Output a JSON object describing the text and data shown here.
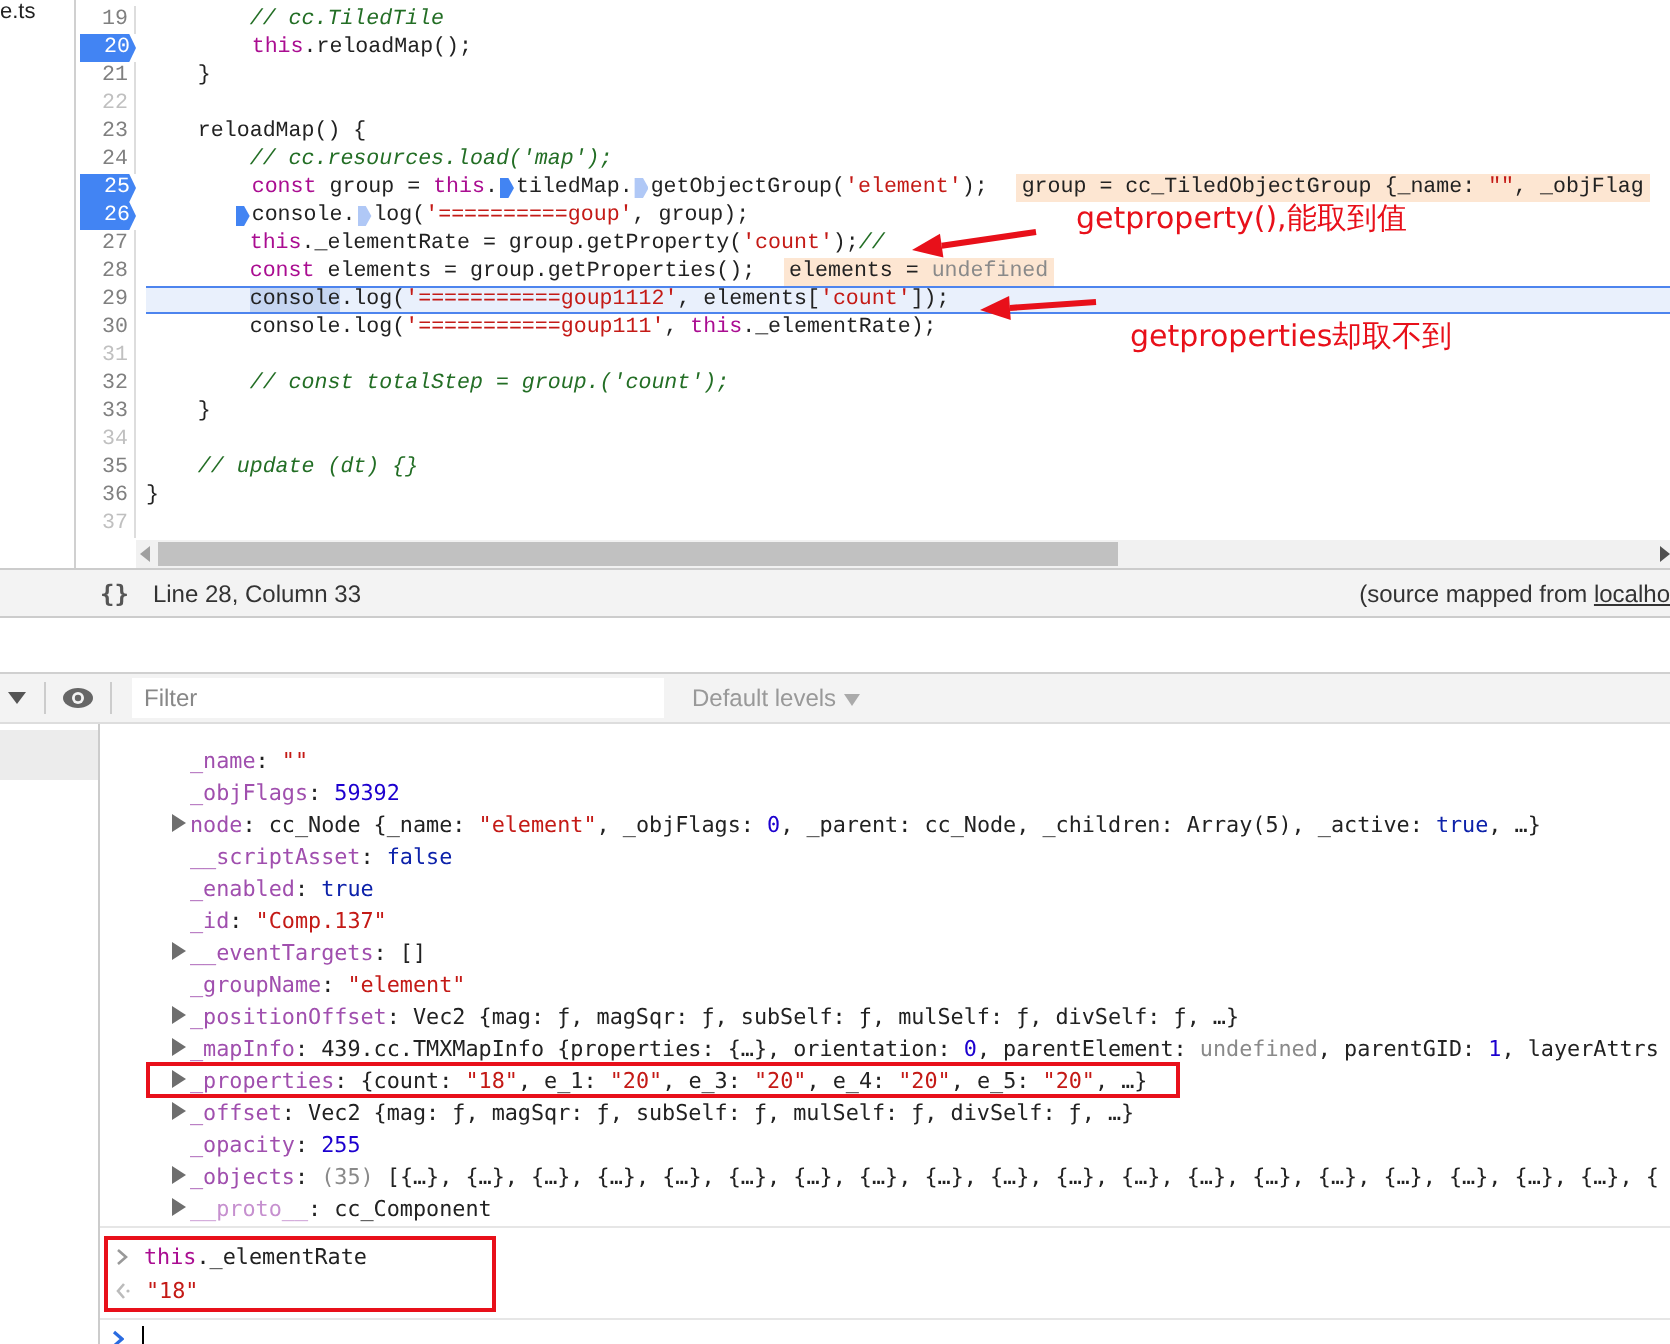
{
  "file_tree": {
    "items": [
      {
        "label": "e.ts"
      }
    ]
  },
  "code": {
    "lines": [
      {
        "number": "19",
        "breakpoint": false,
        "current": false,
        "tokens": [
          {
            "text": "        // cc.TiledTile",
            "kind": "comment"
          }
        ]
      },
      {
        "number": "20",
        "breakpoint": true,
        "current": false,
        "tokens": [
          {
            "text": "        this",
            "kind": "keyword"
          },
          {
            "text": ".reloadMap();",
            "kind": "plain"
          }
        ]
      },
      {
        "number": "21",
        "breakpoint": false,
        "current": false,
        "tokens": [
          {
            "text": "    }",
            "kind": "plain"
          }
        ]
      },
      {
        "number": "22",
        "breakpoint": false,
        "current": false
      },
      {
        "number": "23",
        "breakpoint": false,
        "current": false,
        "tokens": [
          {
            "text": "    reloadMap() {",
            "kind": "plain"
          }
        ]
      },
      {
        "number": "24",
        "breakpoint": false,
        "current": false,
        "tokens": [
          {
            "text": "        // cc.resources.load('map');",
            "kind": "comment"
          }
        ]
      },
      {
        "number": "25",
        "breakpoint": true,
        "current": false,
        "tokens": [
          {
            "text": "        const",
            "kind": "keyword"
          },
          {
            "text": " group = ",
            "kind": "plain"
          },
          {
            "text": "this",
            "kind": "keyword"
          },
          {
            "text": ".",
            "kind": "plain"
          },
          {
            "kind": "marker",
            "active": true
          },
          {
            "text": "tiledMap.",
            "kind": "plain"
          },
          {
            "kind": "marker",
            "active": false
          },
          {
            "text": "getObjectGroup(",
            "kind": "plain"
          },
          {
            "text": "'element'",
            "kind": "string"
          },
          {
            "text": ");",
            "kind": "plain"
          }
        ],
        "hint": [
          {
            "text": "group = cc_TiledObjectGroup {_name: ",
            "kind": "plain"
          },
          {
            "text": "\"\"",
            "kind": "string"
          },
          {
            "text": ", _objFlag",
            "kind": "plain"
          }
        ]
      },
      {
        "number": "26",
        "breakpoint": true,
        "current": false,
        "tokens": [
          {
            "kind": "marker",
            "active": true
          },
          {
            "text": "console.",
            "kind": "plain"
          },
          {
            "kind": "marker",
            "active": false
          },
          {
            "text": "log(",
            "kind": "plain"
          },
          {
            "text": "'==========goup'",
            "kind": "string"
          },
          {
            "text": ", group);",
            "kind": "plain"
          }
        ]
      },
      {
        "number": "27",
        "breakpoint": false,
        "current": false,
        "tokens": [
          {
            "text": "        this",
            "kind": "keyword"
          },
          {
            "text": "._elementRate = group.getProperty(",
            "kind": "plain"
          },
          {
            "text": "'count'",
            "kind": "string"
          },
          {
            "text": ");",
            "kind": "plain"
          },
          {
            "text": "//",
            "kind": "comment"
          }
        ]
      },
      {
        "number": "28",
        "breakpoint": false,
        "current": false,
        "tokens": [
          {
            "text": "        const",
            "kind": "keyword"
          },
          {
            "text": " elements = group.getProperties();",
            "kind": "plain"
          }
        ],
        "hint": [
          {
            "text": "elements = ",
            "kind": "plain"
          },
          {
            "text": "undefined",
            "kind": "gray"
          }
        ]
      },
      {
        "number": "29",
        "breakpoint": false,
        "current": true,
        "tokens": [
          {
            "text": "        console",
            "kind": "selected"
          },
          {
            "text": ".log(",
            "kind": "plain"
          },
          {
            "text": "'===========goup1112'",
            "kind": "string"
          },
          {
            "text": ", elements[",
            "kind": "plain"
          },
          {
            "text": "'count'",
            "kind": "string"
          },
          {
            "text": "]);",
            "kind": "plain"
          }
        ]
      },
      {
        "number": "30",
        "breakpoint": false,
        "current": false,
        "tokens": [
          {
            "text": "        console.log(",
            "kind": "plain"
          },
          {
            "text": "'===========goup111'",
            "kind": "string"
          },
          {
            "text": ", ",
            "kind": "plain"
          },
          {
            "text": "this",
            "kind": "keyword"
          },
          {
            "text": "._elementRate);",
            "kind": "plain"
          }
        ]
      },
      {
        "number": "31",
        "breakpoint": false,
        "current": false
      },
      {
        "number": "32",
        "breakpoint": false,
        "current": false,
        "tokens": [
          {
            "text": "        // const totalStep = group.('count');",
            "kind": "comment"
          }
        ]
      },
      {
        "number": "33",
        "breakpoint": false,
        "current": false,
        "tokens": [
          {
            "text": "    }",
            "kind": "plain"
          }
        ]
      },
      {
        "number": "34",
        "breakpoint": false,
        "current": false
      },
      {
        "number": "35",
        "breakpoint": false,
        "current": false,
        "tokens": [
          {
            "text": "    // update (dt) {}",
            "kind": "comment"
          }
        ]
      },
      {
        "number": "36",
        "breakpoint": false,
        "current": false,
        "tokens": [
          {
            "text": "}",
            "kind": "plain"
          }
        ]
      },
      {
        "number": "37",
        "breakpoint": false,
        "current": false
      }
    ],
    "annotations": [
      {
        "text": "getproperty(),能取到值"
      },
      {
        "text": "getproperties却取不到"
      }
    ]
  },
  "status_bar": {
    "format_button": "{}",
    "position": "Line 28, Column 33",
    "source_prefix": "(source mapped from ",
    "source_link": "localho"
  },
  "console": {
    "filter": {
      "placeholder": "Filter"
    },
    "levels": "Default levels",
    "rows": [
      {
        "expandable": false,
        "boxed": false,
        "tokens": [
          {
            "text": "_name",
            "kind": "key"
          },
          {
            "text": ": ",
            "kind": "plain"
          },
          {
            "text": "\"\"",
            "kind": "string"
          }
        ]
      },
      {
        "expandable": false,
        "boxed": false,
        "tokens": [
          {
            "text": "_objFlags",
            "kind": "key"
          },
          {
            "text": ": ",
            "kind": "plain"
          },
          {
            "text": "59392",
            "kind": "number"
          }
        ]
      },
      {
        "expandable": true,
        "boxed": false,
        "tokens": [
          {
            "text": "node",
            "kind": "key"
          },
          {
            "text": ": cc_Node {_name: ",
            "kind": "plain"
          },
          {
            "text": "\"element\"",
            "kind": "string"
          },
          {
            "text": ", _objFlags: ",
            "kind": "plain"
          },
          {
            "text": "0",
            "kind": "number"
          },
          {
            "text": ", _parent: cc_Node, _children: Array(5), _active: ",
            "kind": "plain"
          },
          {
            "text": "true",
            "kind": "boolean"
          },
          {
            "text": ", …}",
            "kind": "plain"
          }
        ]
      },
      {
        "expandable": false,
        "boxed": false,
        "tokens": [
          {
            "text": "__scriptAsset",
            "kind": "key"
          },
          {
            "text": ": ",
            "kind": "plain"
          },
          {
            "text": "false",
            "kind": "boolean"
          }
        ]
      },
      {
        "expandable": false,
        "boxed": false,
        "tokens": [
          {
            "text": "_enabled",
            "kind": "key"
          },
          {
            "text": ": ",
            "kind": "plain"
          },
          {
            "text": "true",
            "kind": "boolean"
          }
        ]
      },
      {
        "expandable": false,
        "boxed": false,
        "tokens": [
          {
            "text": "_id",
            "kind": "key"
          },
          {
            "text": ": ",
            "kind": "plain"
          },
          {
            "text": "\"Comp.137\"",
            "kind": "string"
          }
        ]
      },
      {
        "expandable": true,
        "boxed": false,
        "tokens": [
          {
            "text": "__eventTargets",
            "kind": "key"
          },
          {
            "text": ": []",
            "kind": "plain"
          }
        ]
      },
      {
        "expandable": false,
        "boxed": false,
        "tokens": [
          {
            "text": "_groupName",
            "kind": "key"
          },
          {
            "text": ": ",
            "kind": "plain"
          },
          {
            "text": "\"element\"",
            "kind": "string"
          }
        ]
      },
      {
        "expandable": true,
        "boxed": false,
        "tokens": [
          {
            "text": "_positionOffset",
            "kind": "key"
          },
          {
            "text": ": Vec2 {mag: ƒ, magSqr: ƒ, subSelf: ƒ, mulSelf: ƒ, divSelf: ƒ, …}",
            "kind": "plain"
          }
        ]
      },
      {
        "expandable": true,
        "boxed": false,
        "tokens": [
          {
            "text": "_mapInfo",
            "kind": "key"
          },
          {
            "text": ": 439.cc.TMXMapInfo {properties: {…}, orientation: ",
            "kind": "plain"
          },
          {
            "text": "0",
            "kind": "number"
          },
          {
            "text": ", parentElement: ",
            "kind": "plain"
          },
          {
            "text": "undefined",
            "kind": "gray"
          },
          {
            "text": ", parentGID: ",
            "kind": "plain"
          },
          {
            "text": "1",
            "kind": "number"
          },
          {
            "text": ", layerAttrs",
            "kind": "plain"
          }
        ]
      },
      {
        "expandable": true,
        "boxed": true,
        "tokens": [
          {
            "text": "_properties",
            "kind": "key"
          },
          {
            "text": ": {count: ",
            "kind": "plain"
          },
          {
            "text": "\"18\"",
            "kind": "string"
          },
          {
            "text": ", e_1: ",
            "kind": "plain"
          },
          {
            "text": "\"20\"",
            "kind": "string"
          },
          {
            "text": ", e_3: ",
            "kind": "plain"
          },
          {
            "text": "\"20\"",
            "kind": "string"
          },
          {
            "text": ", e_4: ",
            "kind": "plain"
          },
          {
            "text": "\"20\"",
            "kind": "string"
          },
          {
            "text": ", e_5: ",
            "kind": "plain"
          },
          {
            "text": "\"20\"",
            "kind": "string"
          },
          {
            "text": ", …}",
            "kind": "plain"
          }
        ]
      },
      {
        "expandable": true,
        "boxed": false,
        "tokens": [
          {
            "text": "_offset",
            "kind": "key"
          },
          {
            "text": ": Vec2 {mag: ƒ, magSqr: ƒ, subSelf: ƒ, mulSelf: ƒ, divSelf: ƒ, …}",
            "kind": "plain"
          }
        ]
      },
      {
        "expandable": false,
        "boxed": false,
        "tokens": [
          {
            "text": "_opacity",
            "kind": "key"
          },
          {
            "text": ": ",
            "kind": "plain"
          },
          {
            "text": "255",
            "kind": "number"
          }
        ]
      },
      {
        "expandable": true,
        "boxed": false,
        "tokens": [
          {
            "text": "_objects",
            "kind": "key"
          },
          {
            "text": ": ",
            "kind": "plain"
          },
          {
            "text": "(35)",
            "kind": "gray"
          },
          {
            "text": " [{…}, {…}, {…}, {…}, {…}, {…}, {…}, {…}, {…}, {…}, {…}, {…}, {…}, {…}, {…}, {…}, {…}, {…}, {…}, {",
            "kind": "plain"
          }
        ]
      },
      {
        "expandable": true,
        "boxed": false,
        "tokens": [
          {
            "text": "__proto__",
            "kind": "proto"
          },
          {
            "text": ": cc_Component",
            "kind": "plain"
          }
        ]
      }
    ],
    "history": {
      "boxed": true,
      "input": [
        {
          "text": "this",
          "kind": "keyword"
        },
        {
          "text": "._elementRate",
          "kind": "plain"
        }
      ],
      "output": [
        {
          "text": "\"18\"",
          "kind": "string"
        }
      ]
    }
  }
}
